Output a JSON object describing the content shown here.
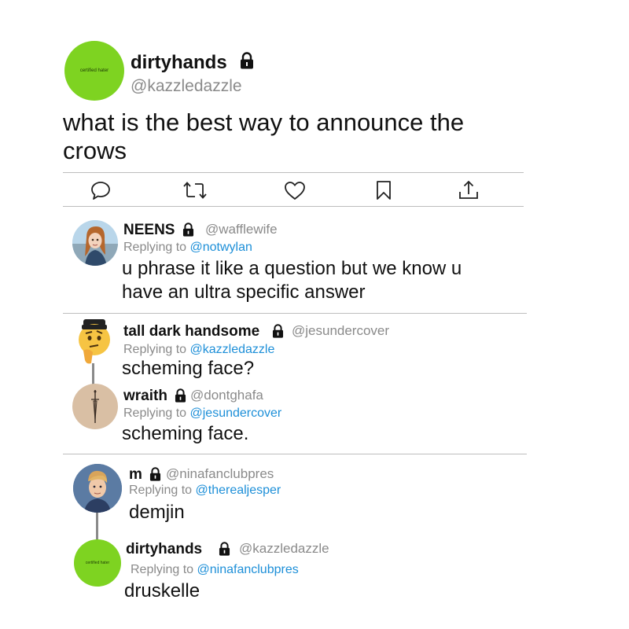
{
  "main_post": {
    "avatar_text": "certified hater",
    "name": "dirtyhands",
    "handle": "@kazzledazzle",
    "text_line1": "what is the best way to announce the",
    "text_line2": "crows"
  },
  "actions": [
    "reply-icon",
    "retweet-icon",
    "like-icon",
    "bookmark-icon",
    "share-icon"
  ],
  "replies": [
    {
      "name": "NEENS",
      "handle": "@wafflewife",
      "replying_prefix": "Replying to ",
      "replying_to": "@notwylan",
      "text_line1": "u phrase it like a question but we know u",
      "text_line2": "have an ultra specific answer"
    },
    {
      "name": "tall dark handsome",
      "handle": "@jesundercover",
      "replying_prefix": "Replying to ",
      "replying_to": "@kazzledazzle",
      "text": "scheming face?"
    },
    {
      "name": "wraith",
      "handle": "@dontghafa",
      "replying_prefix": "Replying to ",
      "replying_to": "@jesundercover",
      "text": "scheming face."
    },
    {
      "name": "m",
      "handle": "@ninafanclubpres",
      "replying_prefix": "Replying to ",
      "replying_to": "@therealjesper",
      "text": "demjin"
    },
    {
      "name": "dirtyhands",
      "handle": "@kazzledazzle",
      "avatar_text": "certified hater",
      "replying_prefix": "Replying to ",
      "replying_to": "@ninafanclubpres",
      "text": "druskelle"
    }
  ],
  "colors": {
    "avatar_green": "#7ed321",
    "mention_blue": "#1d8fd8",
    "muted": "#8a8a8a"
  }
}
